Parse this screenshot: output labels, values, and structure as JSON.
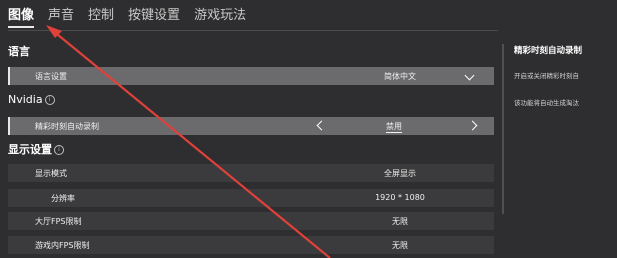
{
  "tabs": [
    {
      "label": "图像",
      "active": true
    },
    {
      "label": "声音"
    },
    {
      "label": "控制"
    },
    {
      "label": "按键设置"
    },
    {
      "label": "游戏玩法"
    }
  ],
  "sections": {
    "language": "语言",
    "nvidia": "Nvidia",
    "display": "显示设置"
  },
  "rows": {
    "language_setting": {
      "label": "语言设置",
      "value": "简体中文"
    },
    "highlights": {
      "label": "精彩时刻自动录制",
      "value": "禁用"
    },
    "display_mode": {
      "label": "显示模式",
      "value": "全屏显示"
    },
    "resolution": {
      "label": "分辨率",
      "value": "1920 * 1080"
    },
    "lobby_fps": {
      "label": "大厅FPS限制",
      "value": "无限"
    },
    "ingame_fps": {
      "label": "游戏内FPS限制",
      "value": "无限"
    }
  },
  "panel": {
    "title": "精彩时刻自动录制",
    "line1": "开启或关闭精彩时刻自",
    "line2": "该功能将自动生成淘汰"
  },
  "icons": {
    "info": "info-circle-icon",
    "dropdown": "chevron-down-icon",
    "prev": "chevron-left-icon",
    "next": "chevron-right-icon"
  },
  "colors": {
    "background": "#2e2e30",
    "row_highlight": "#6b6b6e",
    "row_dark": "#3b3b3d",
    "annotation_arrow": "#e0413a"
  }
}
